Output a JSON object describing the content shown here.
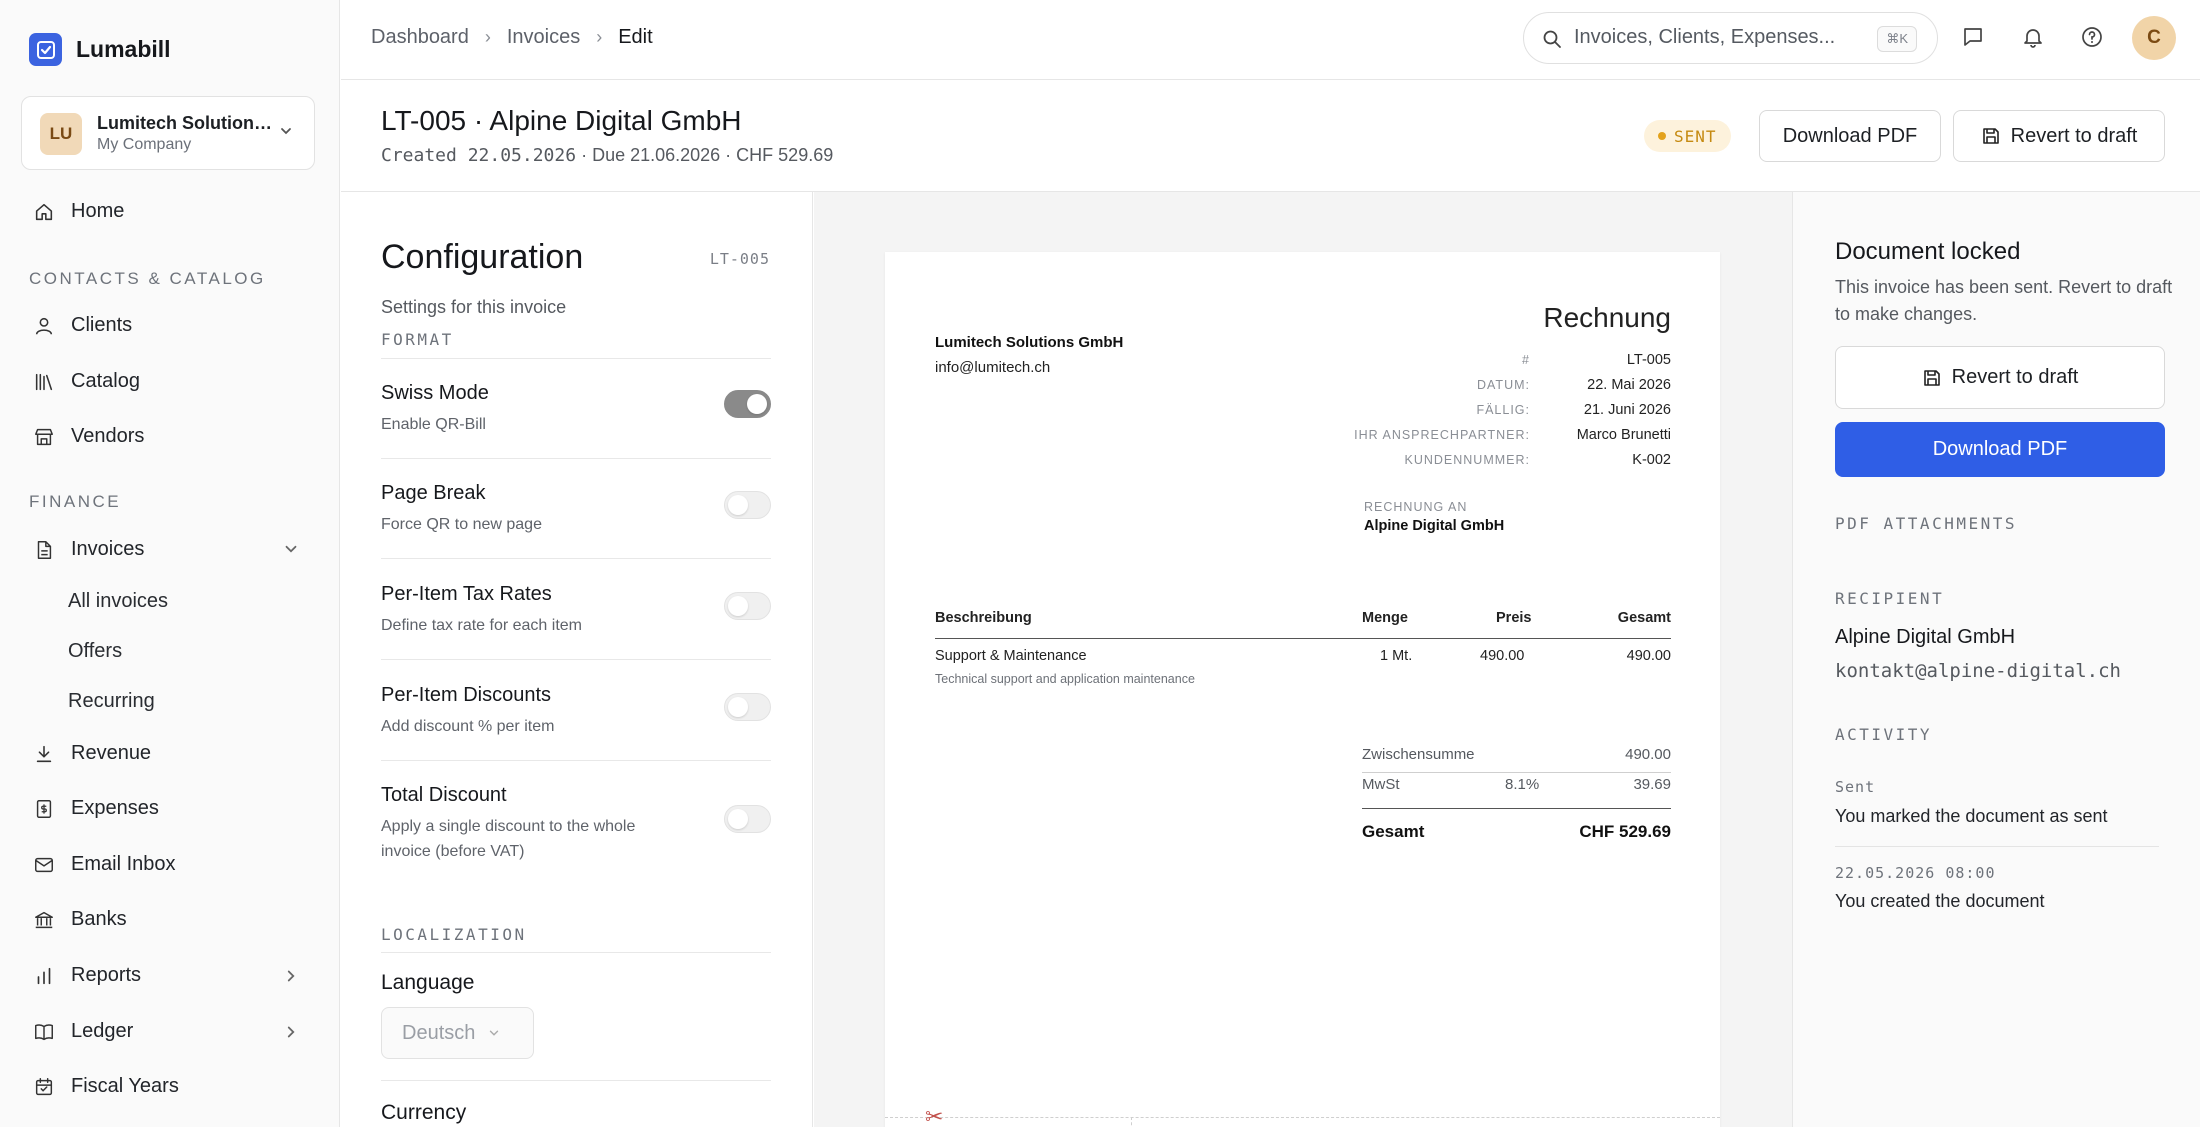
{
  "app": {
    "name": "Lumabill"
  },
  "company": {
    "initials": "LU",
    "name": "Lumitech Solution…",
    "subtitle": "My Company"
  },
  "sidebar": {
    "home": "Home",
    "section_contacts": "CONTACTS & CATALOG",
    "clients": "Clients",
    "catalog": "Catalog",
    "vendors": "Vendors",
    "section_finance": "FINANCE",
    "invoices": "Invoices",
    "all_invoices": "All invoices",
    "offers": "Offers",
    "recurring": "Recurring",
    "revenue": "Revenue",
    "expenses": "Expenses",
    "email_inbox": "Email Inbox",
    "banks": "Banks",
    "reports": "Reports",
    "ledger": "Ledger",
    "fiscal_years": "Fiscal Years"
  },
  "breadcrumb": [
    "Dashboard",
    "Invoices",
    "Edit"
  ],
  "search": {
    "placeholder": "Invoices, Clients, Expenses...",
    "shortcut": "⌘K"
  },
  "user": {
    "initial": "C"
  },
  "header": {
    "title": "LT-005 · Alpine Digital GmbH",
    "subtitle_created": "Created 22.05.2026",
    "subtitle_rest": " · Due 21.06.2026 · CHF 529.69",
    "status": "SENT",
    "download_pdf": "Download PDF",
    "revert_to_draft": "Revert to draft"
  },
  "config": {
    "title": "Configuration",
    "code": "LT-005",
    "subtitle": "Settings for this invoice",
    "section_format": "FORMAT",
    "options": [
      {
        "title": "Swiss Mode",
        "desc": "Enable QR-Bill",
        "on": true
      },
      {
        "title": "Page Break",
        "desc": "Force QR to new page",
        "on": false
      },
      {
        "title": "Per-Item Tax Rates",
        "desc": "Define tax rate for each item",
        "on": false
      },
      {
        "title": "Per-Item Discounts",
        "desc": "Add discount % per item",
        "on": false
      },
      {
        "title": "Total Discount",
        "desc": "Apply a single discount to the whole invoice (before VAT)",
        "on": false
      }
    ],
    "section_localization": "LOCALIZATION",
    "language_label": "Language",
    "language_value": "Deutsch",
    "currency_label": "Currency"
  },
  "invoice": {
    "from_name": "Lumitech Solutions GmbH",
    "from_email": "info@lumitech.ch",
    "heading": "Rechnung",
    "meta": [
      {
        "label": "#",
        "value": "LT-005"
      },
      {
        "label": "DATUM:",
        "value": "22. Mai 2026"
      },
      {
        "label": "FÄLLIG:",
        "value": "21. Juni 2026"
      },
      {
        "label": "IHR ANSPRECHPARTNER:",
        "value": "Marco Brunetti"
      },
      {
        "label": "KUNDENNUMMER:",
        "value": "K-002"
      }
    ],
    "bill_to_label": "RECHNUNG AN",
    "bill_to_name": "Alpine Digital GmbH",
    "columns": {
      "description": "Beschreibung",
      "quantity": "Menge",
      "price": "Preis",
      "total": "Gesamt"
    },
    "items": [
      {
        "name": "Support & Maintenance",
        "desc": "Technical support and application maintenance",
        "qty": "1 Mt.",
        "price": "490.00",
        "total": "490.00"
      }
    ],
    "subtotal_label": "Zwischensumme",
    "subtotal_value": "490.00",
    "vat_label": "MwSt",
    "vat_rate": "8.1%",
    "vat_value": "39.69",
    "grand_label": "Gesamt",
    "grand_value": "CHF 529.69"
  },
  "rpanel": {
    "lock_title": "Document locked",
    "lock_desc": "This invoice has been sent. Revert to draft to make changes.",
    "revert_to_draft": "Revert to draft",
    "download_pdf": "Download PDF",
    "section_attachments": "PDF ATTACHMENTS",
    "section_recipient": "RECIPIENT",
    "recipient_name": "Alpine Digital GmbH",
    "recipient_email": "kontakt@alpine-digital.ch",
    "section_activity": "ACTIVITY",
    "activity": [
      {
        "meta": "Sent",
        "text": "You marked the document as sent"
      },
      {
        "meta": "22.05.2026 08:00",
        "text": "You created the document"
      }
    ]
  }
}
